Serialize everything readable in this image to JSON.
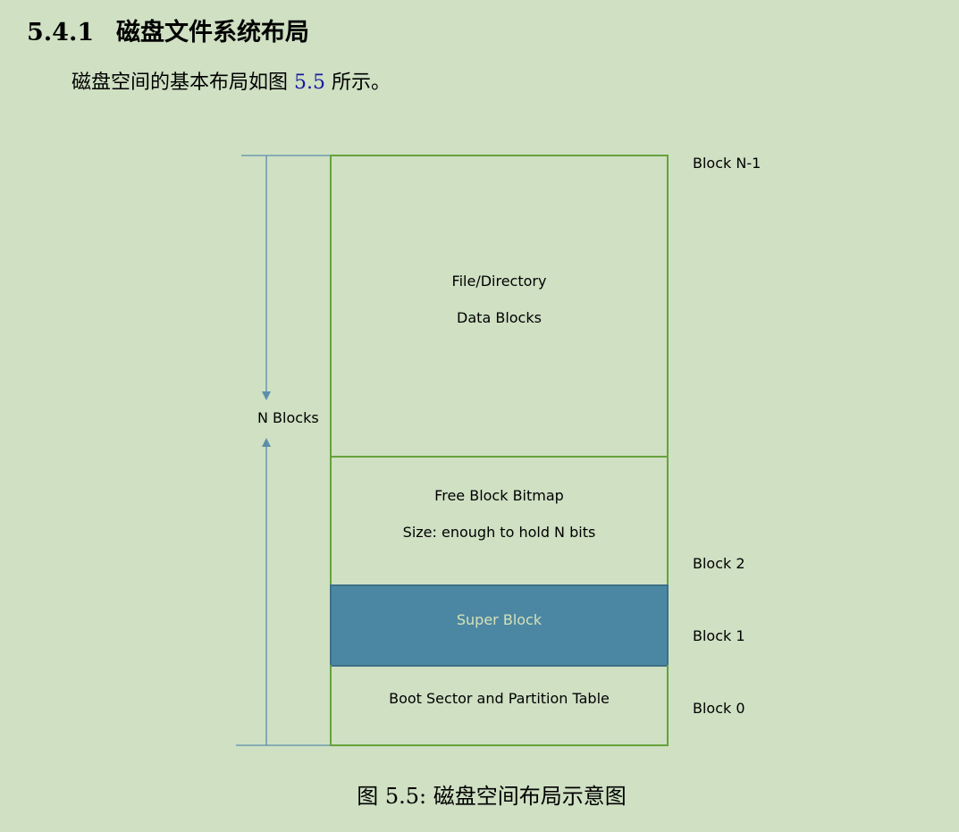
{
  "section": {
    "number": "5.4.1",
    "title": "磁盘文件系统布局"
  },
  "paragraph": {
    "before": "磁盘空间的基本布局如图 ",
    "ref": "5.5",
    "after": " 所示。"
  },
  "figure": {
    "regions": {
      "data": {
        "line1": "File/Directory",
        "line2": "Data Blocks"
      },
      "bitmap": {
        "line1": "Free Block Bitmap",
        "line2": "Size: enough to hold N bits"
      },
      "super": {
        "line1": "Super Block"
      },
      "boot": {
        "line1": "Boot Sector and Partition Table"
      }
    },
    "block_labels": {
      "top": "Block N-1",
      "block2": "Block 2",
      "block1": "Block 1",
      "block0": "Block 0"
    },
    "extent_label": "N Blocks",
    "colors": {
      "background": "#cfe0c3",
      "region_border": "#66a23e",
      "super_block_fill": "#4b87a3",
      "arrow": "#5c8eaa",
      "reference": "#1a1aa0"
    }
  },
  "caption": {
    "label": "图 5.5:",
    "text": "磁盘空间布局示意图"
  }
}
